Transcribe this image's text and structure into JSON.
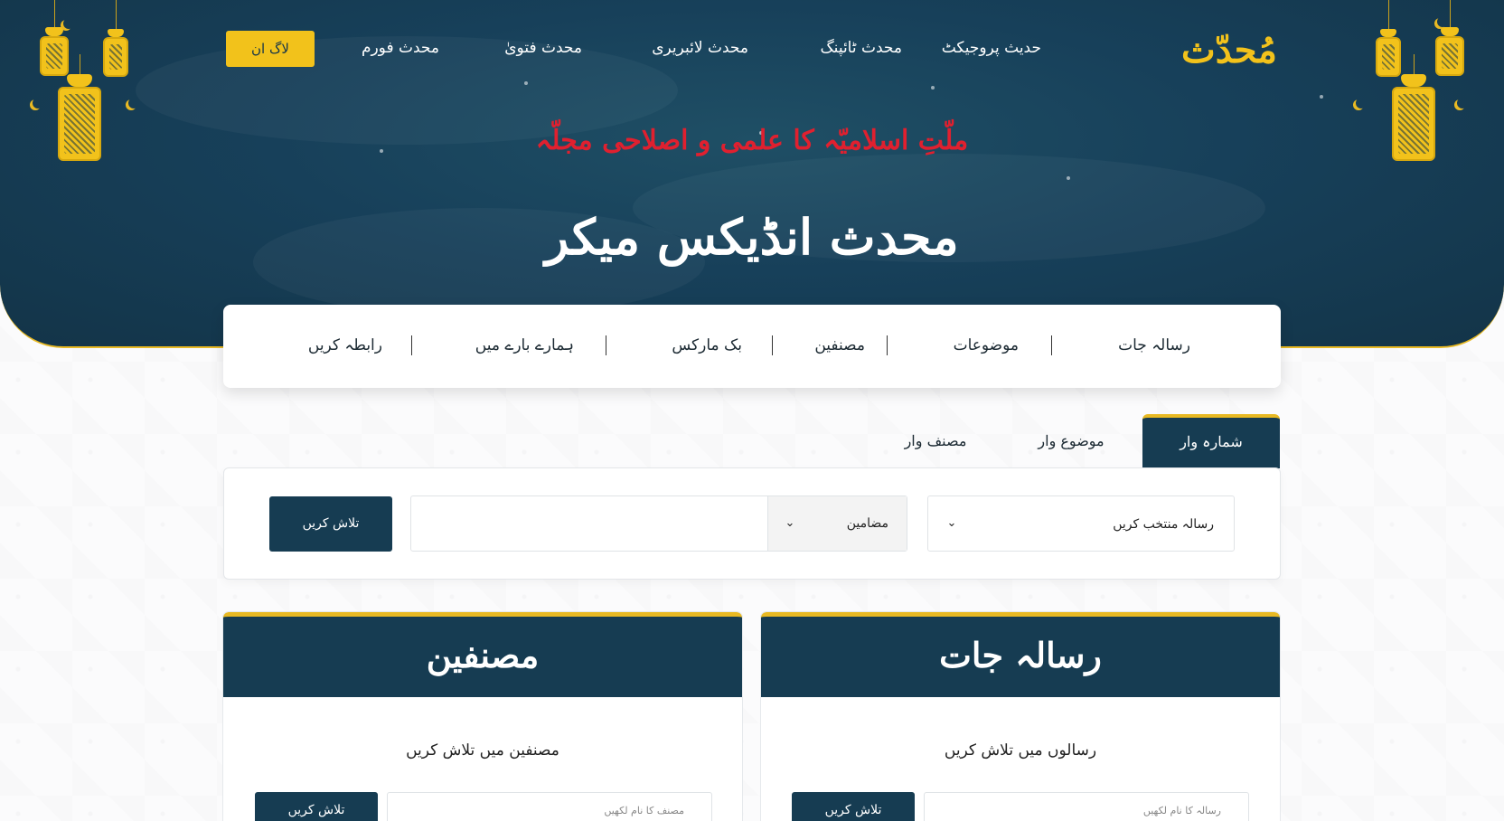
{
  "brand": {
    "logo_text": "مُحدّث"
  },
  "nav": {
    "items": [
      "حدیث پروجیکٹ",
      "محدث ٹائپنگ",
      "محدث لائبریری",
      "محدث فتویٰ",
      "محدث فورم"
    ],
    "login_label": "لاگ ان"
  },
  "hero": {
    "subtitle": "ملّتِ اسلامیّہ کا علمی و اصلاحی مجلّہ",
    "title": "محدث انڈیکس میکر"
  },
  "menu": {
    "items": [
      "رسالہ جات",
      "موضوعات",
      "مصنفین",
      "بک مارکس",
      "ہمارے بارے میں",
      "رابطہ کریں"
    ]
  },
  "tabs": {
    "items": [
      "شمارہ وار",
      "موضوع وار",
      "مصنف وار"
    ],
    "active_index": 0
  },
  "search": {
    "magazine_select": "رسالہ منتخب کریں",
    "type_select": "مضامین",
    "input_value": "",
    "button_label": "تلاش کریں"
  },
  "cards": {
    "magazines": {
      "title": "رسالہ جات",
      "hint": "رسالوں میں تلاش کریں",
      "input_placeholder": "رسالہ کا نام لکھیں",
      "button_label": "تلاش کریں"
    },
    "authors": {
      "title": "مصنفین",
      "hint": "مصنفین میں تلاش کریں",
      "input_placeholder": "مصنف کا نام لکھیں",
      "button_label": "تلاش کریں"
    }
  },
  "icons": {
    "chevron": "chevron-down-icon",
    "lantern": "lantern-icon",
    "moon": "crescent-moon-icon"
  },
  "colors": {
    "primary": "#163c52",
    "accent": "#f2c21b",
    "subtitle_red": "#e0202f"
  }
}
